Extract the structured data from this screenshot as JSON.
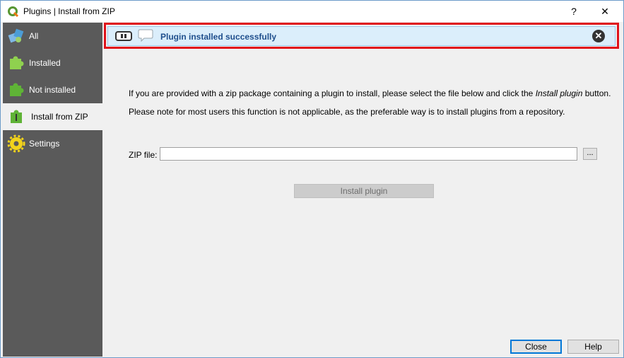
{
  "window": {
    "title": "Plugins | Install from ZIP",
    "help_glyph": "?",
    "close_glyph": "✕"
  },
  "sidebar": {
    "items": [
      {
        "label": "All",
        "icon": "puzzle-pieces-icon"
      },
      {
        "label": "Installed",
        "icon": "green-puzzle-icon"
      },
      {
        "label": "Not installed",
        "icon": "green-puzzle-icon"
      },
      {
        "label": "Install from ZIP",
        "icon": "zip-puzzle-icon",
        "active": true
      },
      {
        "label": "Settings",
        "icon": "gear-icon"
      }
    ]
  },
  "message_bar": {
    "text": "Plugin installed successfully",
    "close_glyph": "✕",
    "highlight_color": "#e0121b"
  },
  "main": {
    "description_part1": "If you are provided with a zip package containing a plugin to install, please select the file below and click the ",
    "description_emphasis": "Install plugin",
    "description_part2": " button.",
    "note": "Please note for most users this function is not applicable, as the preferable way is to install plugins from a repository.",
    "zip_label": "ZIP file:",
    "zip_value": "",
    "browse_label": "...",
    "install_label": "Install plugin"
  },
  "footer": {
    "close_label": "Close",
    "help_label": "Help"
  }
}
